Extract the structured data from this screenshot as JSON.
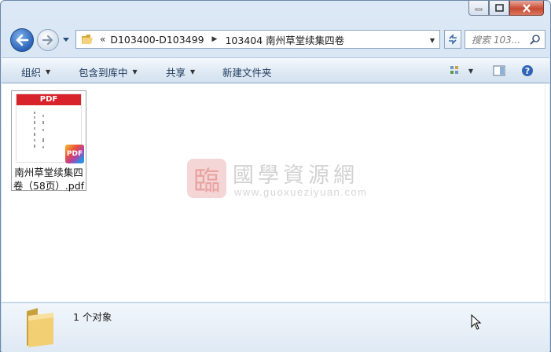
{
  "address": {
    "separator": "«",
    "crumbs": [
      "D103400-D103499",
      "103404 南州草堂续集四卷"
    ]
  },
  "search": {
    "placeholder": "搜索 103..."
  },
  "toolbar": {
    "organize": "组织",
    "include_in_library": "包含到库中",
    "share": "共享",
    "new_folder": "新建文件夹"
  },
  "files": [
    {
      "name": "南州草堂续集四卷（58页）.pdf",
      "thumb_header": "PDF",
      "badge": "PDF"
    }
  ],
  "watermark": {
    "title": "國學資源網",
    "url": "www.guoxueziyuan.com",
    "seal": "臨"
  },
  "details": {
    "count": "1 个对象"
  },
  "colors": {
    "pdf_red": "#d8232a",
    "toolbar_text": "#1e395b",
    "window_bg": "#dce8f5"
  },
  "icons": [
    "minimize-icon",
    "maximize-icon",
    "close-icon",
    "back-arrow-icon",
    "forward-arrow-icon",
    "folder-icon",
    "refresh-icon",
    "search-icon",
    "view-options-icon",
    "preview-pane-icon",
    "help-icon"
  ]
}
